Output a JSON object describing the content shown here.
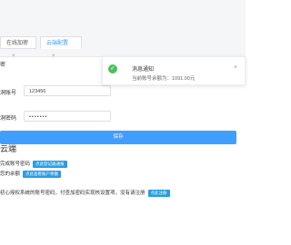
{
  "tabs": [
    {
      "label": "在线加密",
      "close": "×"
    },
    {
      "label": "云端配置",
      "close": "×"
    }
  ],
  "form": {
    "row1_label": "密",
    "account_label": "洞账号",
    "account_value": "123456",
    "password_label": "洞密码",
    "password_mask": "•••••••",
    "save_label": "保存"
  },
  "cloud": {
    "title": "云端",
    "line1_text": "完成账号密码",
    "line1_tag": "点此登记器通报",
    "line2_text": "您的余额",
    "line2_tag": "点此查看账户余额",
    "line3_text": "初心授权系统的账号密码，付查加密码实现核设置项。没有请注册",
    "line3_tag": "点此注册"
  },
  "toast": {
    "title": "消息通知",
    "message": "当前账号余额为：1091.00元",
    "ok_icon": "check-circle-icon",
    "close": "×"
  },
  "colors": {
    "accent": "#409eff",
    "tag": "#2a9de0",
    "success": "#49c15a"
  }
}
